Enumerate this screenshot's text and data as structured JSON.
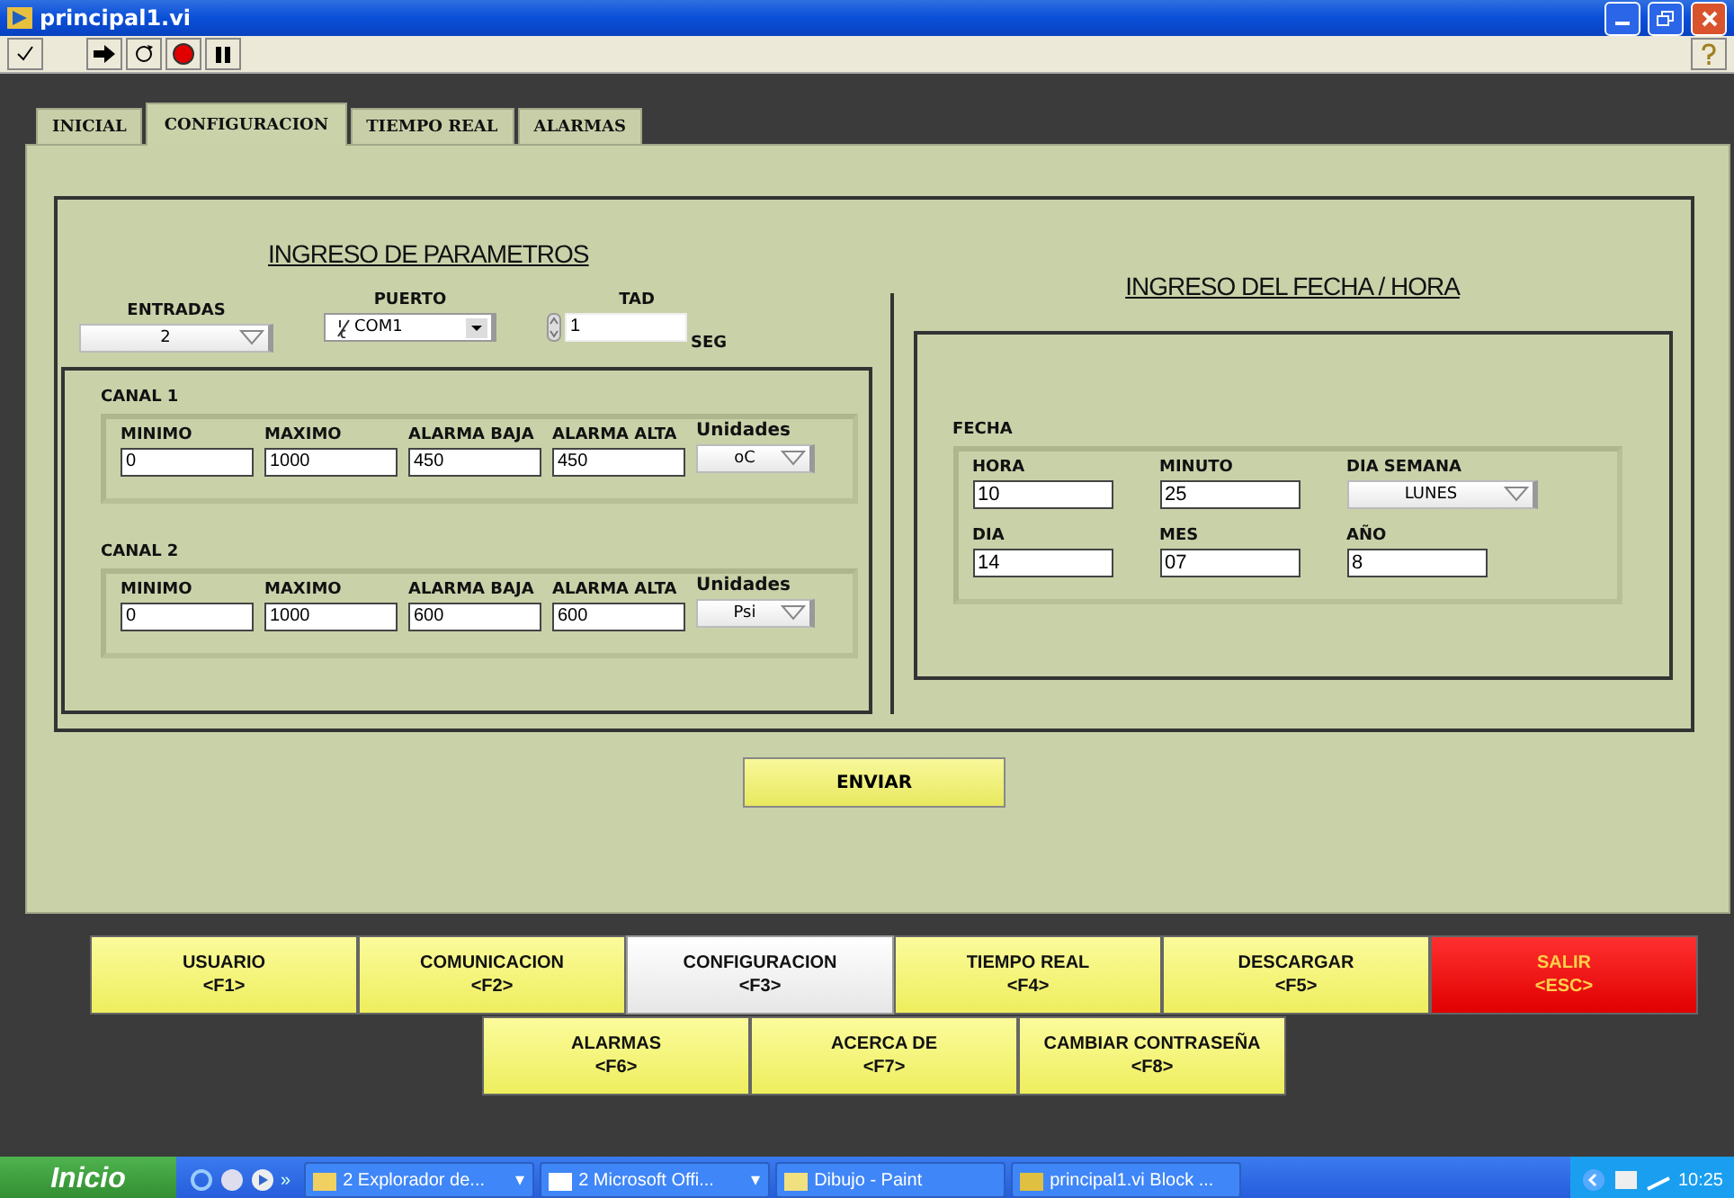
{
  "window": {
    "title": "principal1.vi"
  },
  "tabs": [
    {
      "label": "INICIAL",
      "selected": false
    },
    {
      "label": "CONFIGURACION",
      "selected": true
    },
    {
      "label": "TIEMPO REAL",
      "selected": false
    },
    {
      "label": "ALARMAS",
      "selected": false
    }
  ],
  "parametros": {
    "title": "INGRESO DE PARAMETROS",
    "entradas": {
      "label": "ENTRADAS",
      "value": "2"
    },
    "puerto": {
      "label": "PUERTO",
      "value": "COM1"
    },
    "tad": {
      "label": "TAD",
      "value": "1",
      "unit": "SEG"
    },
    "canales": [
      {
        "title": "CANAL 1",
        "fields": [
          {
            "label": "MINIMO",
            "value": "0"
          },
          {
            "label": "MAXIMO",
            "value": "1000"
          },
          {
            "label": "ALARMA BAJA",
            "value": "450"
          },
          {
            "label": "ALARMA ALTA",
            "value": "450"
          }
        ],
        "unidades": {
          "label": "Unidades",
          "value": "oC"
        }
      },
      {
        "title": "CANAL 2",
        "fields": [
          {
            "label": "MINIMO",
            "value": "0"
          },
          {
            "label": "MAXIMO",
            "value": "1000"
          },
          {
            "label": "ALARMA BAJA",
            "value": "600"
          },
          {
            "label": "ALARMA ALTA",
            "value": "600"
          }
        ],
        "unidades": {
          "label": "Unidades",
          "value": "Psi"
        }
      }
    ]
  },
  "fecha_hora": {
    "title": "INGRESO DEL FECHA / HORA",
    "group": "FECHA",
    "fields": [
      {
        "label": "HORA",
        "value": "10",
        "kind": "input"
      },
      {
        "label": "MINUTO",
        "value": "25",
        "kind": "input"
      },
      {
        "label": "DIA SEMANA",
        "value": "LUNES",
        "kind": "dropdown"
      },
      {
        "label": "DIA",
        "value": "14",
        "kind": "input"
      },
      {
        "label": "MES",
        "value": "07",
        "kind": "input"
      },
      {
        "label": "AÑO",
        "value": "8",
        "kind": "input"
      }
    ]
  },
  "send_button": "ENVIAR",
  "nav_buttons": [
    [
      {
        "label": "USUARIO",
        "key": "<F1>",
        "selected": false,
        "kind": "normal"
      },
      {
        "label": "COMUNICACION",
        "key": "<F2>",
        "selected": false,
        "kind": "normal"
      },
      {
        "label": "CONFIGURACION",
        "key": "<F3>",
        "selected": true,
        "kind": "normal"
      },
      {
        "label": "TIEMPO REAL",
        "key": "<F4>",
        "selected": false,
        "kind": "normal"
      },
      {
        "label": "DESCARGAR",
        "key": "<F5>",
        "selected": false,
        "kind": "normal"
      },
      {
        "label": "SALIR",
        "key": "<ESC>",
        "selected": false,
        "kind": "danger"
      }
    ],
    [
      {
        "label": "ALARMAS",
        "key": "<F6>",
        "selected": false,
        "kind": "normal"
      },
      {
        "label": "ACERCA DE",
        "key": "<F7>",
        "selected": false,
        "kind": "normal"
      },
      {
        "label": "CAMBIAR CONTRASEÑA",
        "key": "<F8>",
        "selected": false,
        "kind": "normal"
      }
    ]
  ],
  "taskbar": {
    "start": "Inicio",
    "quicklaunch_more": "»",
    "tasks": [
      {
        "label": "2 Explorador de...",
        "menu": "▾"
      },
      {
        "label": "2 Microsoft Offi...",
        "menu": "▾"
      },
      {
        "label": "Dibujo - Paint"
      },
      {
        "label": "principal1.vi Block ..."
      }
    ],
    "clock": "10:25"
  }
}
